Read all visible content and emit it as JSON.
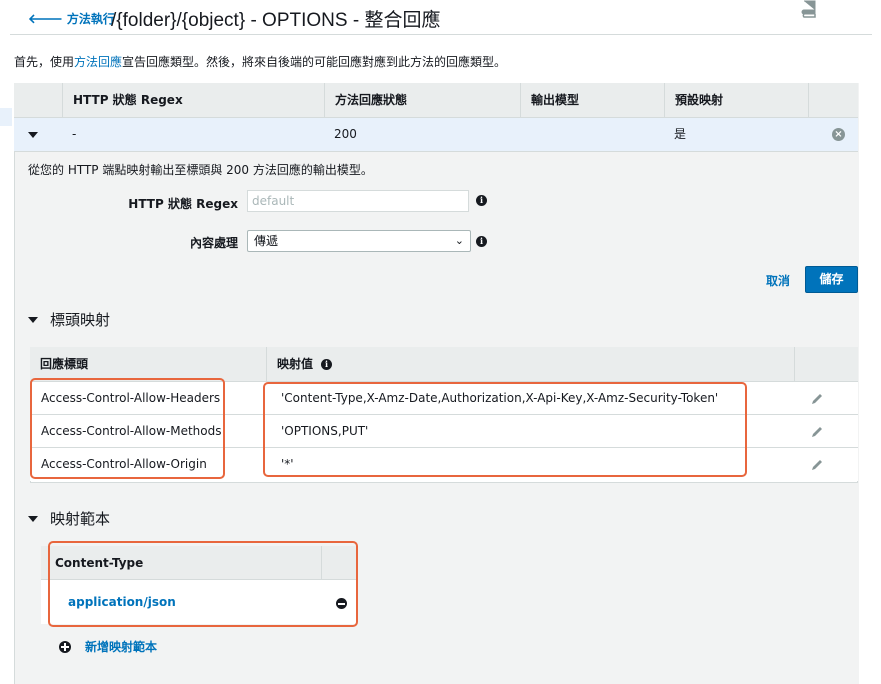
{
  "header": {
    "back_label": "方法執行",
    "title": "/{folder}/{object} - OPTIONS - 整合回應"
  },
  "intro": {
    "before": "首先，使用",
    "link": "方法回應",
    "after": "宣告回應類型。然後，將來自後端的可能回應對應到此方法的回應類型。"
  },
  "responses_table": {
    "columns": [
      "HTTP 狀態 Regex",
      "方法回應狀態",
      "輸出模型",
      "預設映射"
    ],
    "rows": [
      {
        "regex": "-",
        "status": "200",
        "model": "",
        "default": "是"
      }
    ]
  },
  "mapping": {
    "description": "從您的 HTTP 端點映射輸出至標頭與 200 方法回應的輸出模型。",
    "regex_label": "HTTP 狀態 Regex",
    "regex_placeholder": "default",
    "content_handling_label": "內容處理",
    "content_handling_value": "傳遞",
    "cancel_label": "取消",
    "save_label": "儲存"
  },
  "header_mappings": {
    "section_title": "標頭映射",
    "columns": [
      "回應標頭",
      "映射值"
    ],
    "rows": [
      {
        "header": "Access-Control-Allow-Headers",
        "value": "'Content-Type,X-Amz-Date,Authorization,X-Api-Key,X-Amz-Security-Token'"
      },
      {
        "header": "Access-Control-Allow-Methods",
        "value": "'OPTIONS,PUT'"
      },
      {
        "header": "Access-Control-Allow-Origin",
        "value": "'*'"
      }
    ]
  },
  "mapping_templates": {
    "section_title": "映射範本",
    "column": "Content-Type",
    "items": [
      "application/json"
    ],
    "add_label": "新增映射範本"
  },
  "colors": {
    "link": "#0073bb",
    "primary_button": "#0073bb",
    "highlight": "#e8663d",
    "panel_bg": "#f2f3f3",
    "selected_row": "#e8f1fb"
  },
  "icons": [
    "back-arrow-icon",
    "book-icon",
    "caret-down-icon",
    "close-circle-icon",
    "info-icon",
    "chevron-down-icon",
    "pencil-icon",
    "minus-circle-icon",
    "plus-circle-icon"
  ]
}
